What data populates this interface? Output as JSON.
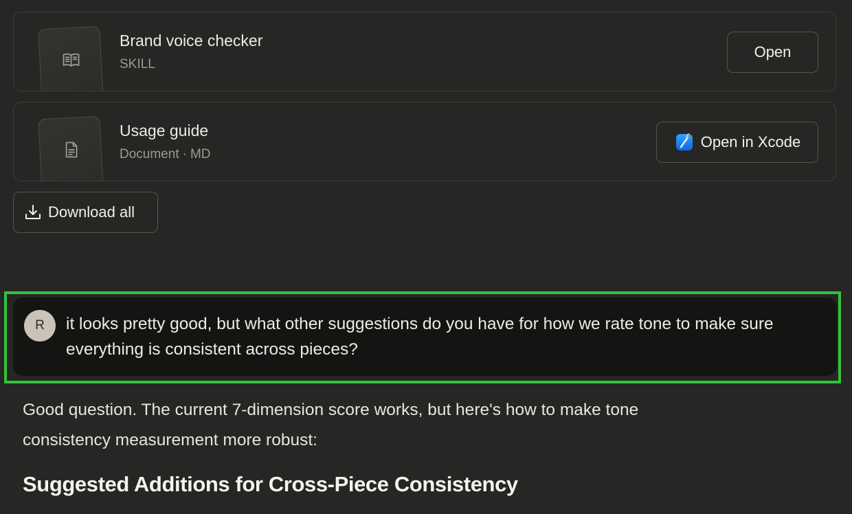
{
  "files": [
    {
      "title": "Brand voice checker",
      "kind": "SKILL",
      "format": "",
      "icon": "book-icon",
      "action_label": "Open"
    },
    {
      "title": "Usage guide",
      "kind": "Document",
      "separator": "·",
      "format": "MD",
      "icon": "document-icon",
      "action_label": "Open in Xcode",
      "action_icon": "xcode-icon"
    }
  ],
  "download_all_label": "Download all",
  "user_message": {
    "avatar_initial": "R",
    "text": "it looks pretty good, but what other suggestions do you have for how we rate tone to make sure everything is consistent across pieces?"
  },
  "assistant": {
    "intro": "Good question. The current 7-dimension score works, but here's how to make tone consistency measurement more robust:",
    "heading": "Suggested Additions for Cross-Piece Consistency"
  },
  "colors": {
    "background": "#262624",
    "user_bubble": "#141413",
    "highlight": "#2fc43b",
    "avatar": "#c9c4b7"
  }
}
